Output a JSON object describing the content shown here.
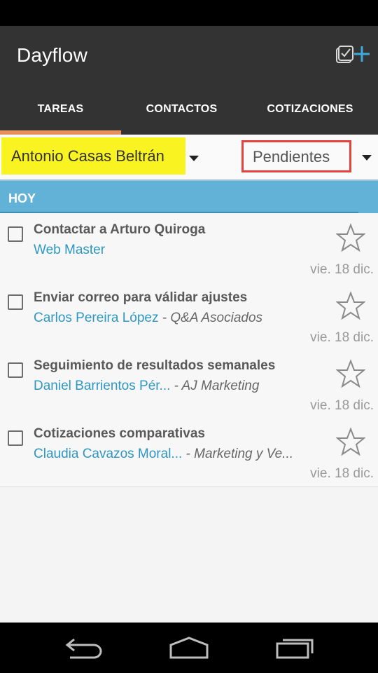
{
  "app": {
    "title": "Dayflow",
    "colors": {
      "appbar": "#333333",
      "accent_tab": "#e8905c",
      "section": "#62b1d6",
      "link": "#2d97c2",
      "highlight_yellow": "#f8f321",
      "highlight_red": "#e5413d"
    }
  },
  "tabs": [
    {
      "label": "TAREAS",
      "selected": true
    },
    {
      "label": "CONTACTOS",
      "selected": false
    },
    {
      "label": "COTIZACIONES",
      "selected": false
    }
  ],
  "filters": {
    "contact": "Antonio Casas Beltrán",
    "status": "Pendientes"
  },
  "section": {
    "label": "HOY"
  },
  "tasks": [
    {
      "title": "Contactar a Arturo Quiroga",
      "contact": "Web Master",
      "company": "",
      "date": "vie. 18 dic.",
      "starred": false
    },
    {
      "title": "Enviar correo para válidar ajustes",
      "contact": "Carlos Pereira López",
      "company": "- Q&A Asociados",
      "date": "vie. 18 dic.",
      "starred": false
    },
    {
      "title": "Seguimiento de resultados semanales",
      "contact": "Daniel Barrientos Pér...",
      "company": "- AJ Marketing",
      "date": "vie. 18 dic.",
      "starred": false
    },
    {
      "title": "Cotizaciones comparativas",
      "contact": "Claudia Cavazos Moral...",
      "company": "- Marketing y Ve...",
      "date": "vie. 18 dic.",
      "starred": false
    }
  ],
  "icons": {
    "add_task": "checklist-plus-icon",
    "star": "star-outline-icon",
    "checkbox": "checkbox-empty-icon",
    "nav": [
      "back-icon",
      "home-icon",
      "recents-icon"
    ]
  }
}
